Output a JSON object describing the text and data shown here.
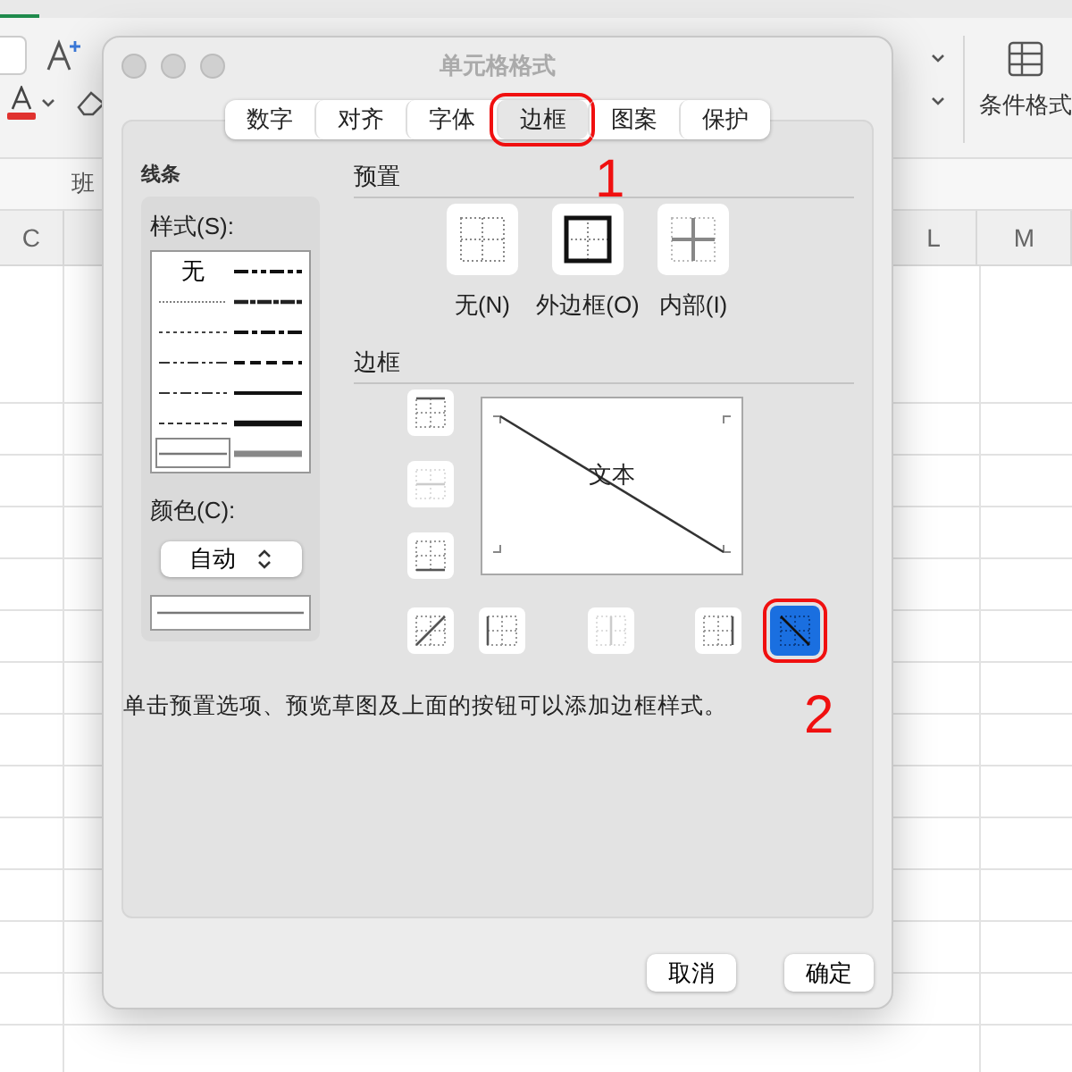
{
  "ribbon": {
    "conditional_format_label": "条件格式"
  },
  "sheet": {
    "cell_text": "班",
    "columns": [
      {
        "label": "C"
      },
      {
        "label": "L"
      },
      {
        "label": "M"
      }
    ]
  },
  "dialog": {
    "title": "单元格格式",
    "tabs": [
      {
        "label": "数字",
        "selected": false,
        "annotated": false
      },
      {
        "label": "对齐",
        "selected": false,
        "annotated": false
      },
      {
        "label": "字体",
        "selected": false,
        "annotated": false
      },
      {
        "label": "边框",
        "selected": true,
        "annotated": true
      },
      {
        "label": "图案",
        "selected": false,
        "annotated": false
      },
      {
        "label": "保护",
        "selected": false,
        "annotated": false
      }
    ],
    "line": {
      "title": "线条",
      "style_label": "样式(S):",
      "none_label": "无",
      "styles": [
        {
          "kind": "none",
          "selected": false
        },
        {
          "kind": "medium-dash-dot-dot",
          "selected": false
        },
        {
          "kind": "hair",
          "selected": false
        },
        {
          "kind": "slant-dash-dot",
          "selected": false
        },
        {
          "kind": "dotted",
          "selected": false
        },
        {
          "kind": "medium-dash-dot",
          "selected": false
        },
        {
          "kind": "dash-dot-dot",
          "selected": false
        },
        {
          "kind": "medium-dashed",
          "selected": false
        },
        {
          "kind": "dash-dot",
          "selected": false
        },
        {
          "kind": "medium",
          "selected": false
        },
        {
          "kind": "dashed",
          "selected": false
        },
        {
          "kind": "thick",
          "selected": false
        },
        {
          "kind": "thin",
          "selected": true
        },
        {
          "kind": "double",
          "selected": false
        }
      ],
      "color_label": "颜色(C):",
      "color_value": "自动"
    },
    "presets": {
      "title": "预置",
      "items": [
        {
          "kind": "none",
          "label": "无(N)"
        },
        {
          "kind": "outline",
          "label": "外边框(O)"
        },
        {
          "kind": "inside",
          "label": "内部(I)"
        }
      ]
    },
    "border": {
      "title": "边框",
      "preview_text": "文本",
      "buttons": [
        {
          "kind": "top",
          "selected": false,
          "disabled": false,
          "annotated": false
        },
        {
          "kind": "inside-horizontal",
          "selected": false,
          "disabled": true,
          "annotated": false
        },
        {
          "kind": "bottom",
          "selected": false,
          "disabled": false,
          "annotated": false
        },
        {
          "kind": "diagonal-up",
          "selected": false,
          "disabled": false,
          "annotated": false
        },
        {
          "kind": "left",
          "selected": false,
          "disabled": false,
          "annotated": false
        },
        {
          "kind": "inside-vertical",
          "selected": false,
          "disabled": true,
          "annotated": false
        },
        {
          "kind": "right",
          "selected": false,
          "disabled": false,
          "annotated": false
        },
        {
          "kind": "diagonal-down",
          "selected": true,
          "disabled": false,
          "annotated": true
        }
      ]
    },
    "hint": "单击预置选项、预览草图及上面的按钮可以添加边框样式。",
    "buttons": [
      "取消",
      "确定"
    ]
  },
  "annotations": [
    {
      "label": "1"
    },
    {
      "label": "2"
    }
  ]
}
